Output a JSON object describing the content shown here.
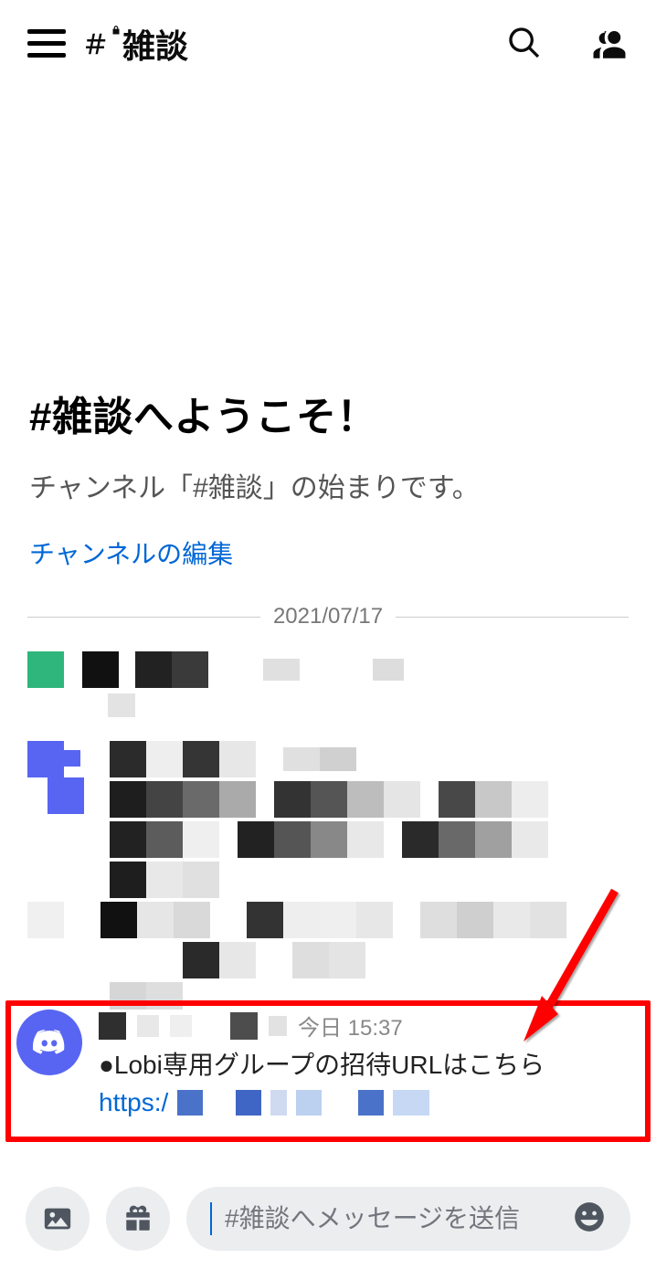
{
  "header": {
    "channel_name": "雑談"
  },
  "welcome": {
    "title": "#雑談へようこそ！",
    "subtitle": "チャンネル「#雑談」の始まりです。",
    "edit_link": "チャンネルの編集"
  },
  "divider_date": "2021/07/17",
  "highlighted_message": {
    "timestamp_label": "今日 15:37",
    "content": "●Lobi専用グループの招待URLはこちら",
    "link_prefix": "https:/"
  },
  "composer": {
    "placeholder": "#雑談へメッセージを送信"
  },
  "colors": {
    "accent": "#5865f2",
    "link": "#0067d6",
    "highlight_border": "#ff0000"
  }
}
